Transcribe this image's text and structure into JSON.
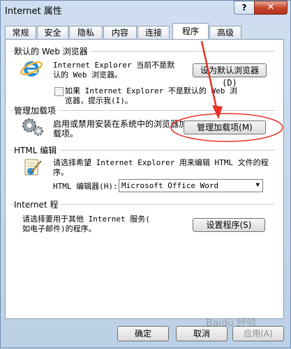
{
  "window": {
    "title": "Internet 属性",
    "help_label": "?",
    "close_label": "✕"
  },
  "tabs": [
    {
      "label": "常规"
    },
    {
      "label": "安全"
    },
    {
      "label": "隐私"
    },
    {
      "label": "内容"
    },
    {
      "label": "连接"
    },
    {
      "label": "程序",
      "active": true
    },
    {
      "label": "高级"
    }
  ],
  "default_browser": {
    "group_title": "默认的 Web 浏览器",
    "status_line1": "Internet Explorer 当前不是默",
    "status_line2": "认的 Web 浏览器。",
    "button_label": "设为默认浏览器(D)",
    "checkbox_line1": "如果 Internet Explorer 不是默认的 Web 浏",
    "checkbox_line2": "览器，提示我(I)。",
    "checkbox_checked": false
  },
  "addons": {
    "group_title": "管理加载项",
    "desc_line1": "启用或禁用安装在系统中的浏览器加",
    "desc_line2": "载项。",
    "button_label": "管理加载项(M)"
  },
  "html_editing": {
    "group_title": "HTML 编辑",
    "desc_line1": "请选择希望 Internet Explorer 用来编辑 HTML 文件的程",
    "desc_line2": "序。",
    "editor_label": "HTML 编辑器(H):",
    "editor_value": "Microsoft Office Word"
  },
  "internet_programs": {
    "group_title": "Internet 程",
    "desc_line1": "请选择要用于其他 Internet 服务(",
    "desc_line2": "如电子邮件)的程序。",
    "button_label": "设置程序(S)"
  },
  "footer": {
    "ok_label": "确定",
    "cancel_label": "取消",
    "apply_label": "应用(A)"
  },
  "watermark": {
    "text": "Baidu 经验"
  },
  "annotation": {
    "color": "#e8322a"
  }
}
